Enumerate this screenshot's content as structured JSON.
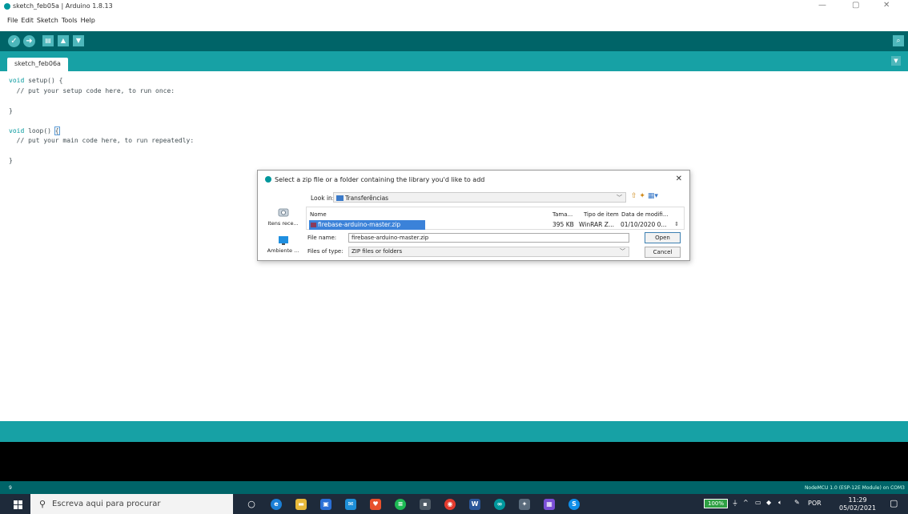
{
  "window": {
    "title": "sketch_feb05a | Arduino 1.8.13",
    "minimize": "—",
    "maximize": "▢",
    "close": "✕"
  },
  "menu": [
    "File",
    "Edit",
    "Sketch",
    "Tools",
    "Help"
  ],
  "toolbar": {
    "verify_icon": "check-icon",
    "upload_icon": "arrow-right-icon",
    "new_icon": "new-file-icon",
    "open_icon": "arrow-up-icon",
    "save_icon": "arrow-down-icon",
    "serial_icon": "search-icon"
  },
  "tab": {
    "label": "sketch_feb06a"
  },
  "editor": {
    "lines": [
      {
        "kw": "void",
        "rest": " setup() {"
      },
      {
        "kw": "",
        "rest": "  // put your setup code here, to run once:"
      },
      {
        "kw": "",
        "rest": ""
      },
      {
        "kw": "",
        "rest": "}"
      },
      {
        "kw": "",
        "rest": ""
      },
      {
        "kw": "void",
        "rest": " loop() "
      },
      {
        "kw": "",
        "rest": "  // put your main code here, to run repeatedly:"
      },
      {
        "kw": "",
        "rest": ""
      },
      {
        "kw": "",
        "rest": "}"
      }
    ],
    "brace": "{"
  },
  "dialog": {
    "title": "Select a zip file or a folder containing the library you'd like to add",
    "look_in_label": "Look in:",
    "look_in_value": "Transferências",
    "places": [
      "Itens rece...",
      "Ambiente ..."
    ],
    "columns": [
      "Nome",
      "Tama...",
      "Tipo de item",
      "Data de modifi..."
    ],
    "file": {
      "name": "firebase-arduino-master.zip",
      "size": "395 KB",
      "type": "WinRAR Z...",
      "date": "01/10/2020 0..."
    },
    "file_name_label": "File name:",
    "file_name_value": "firebase-arduino-master.zip",
    "files_of_type_label": "Files of type:",
    "files_of_type_value": "ZIP files or folders",
    "open_button": "Open",
    "cancel_button": "Cancel"
  },
  "status": {
    "line_number": "9",
    "board": "NodeMCU 1.0 (ESP-12E Module) on COM3"
  },
  "taskbar": {
    "search_placeholder": "Escreva aqui para procurar",
    "battery": "100%",
    "language": "POR",
    "time": "11:29",
    "date": "05/02/2021"
  }
}
